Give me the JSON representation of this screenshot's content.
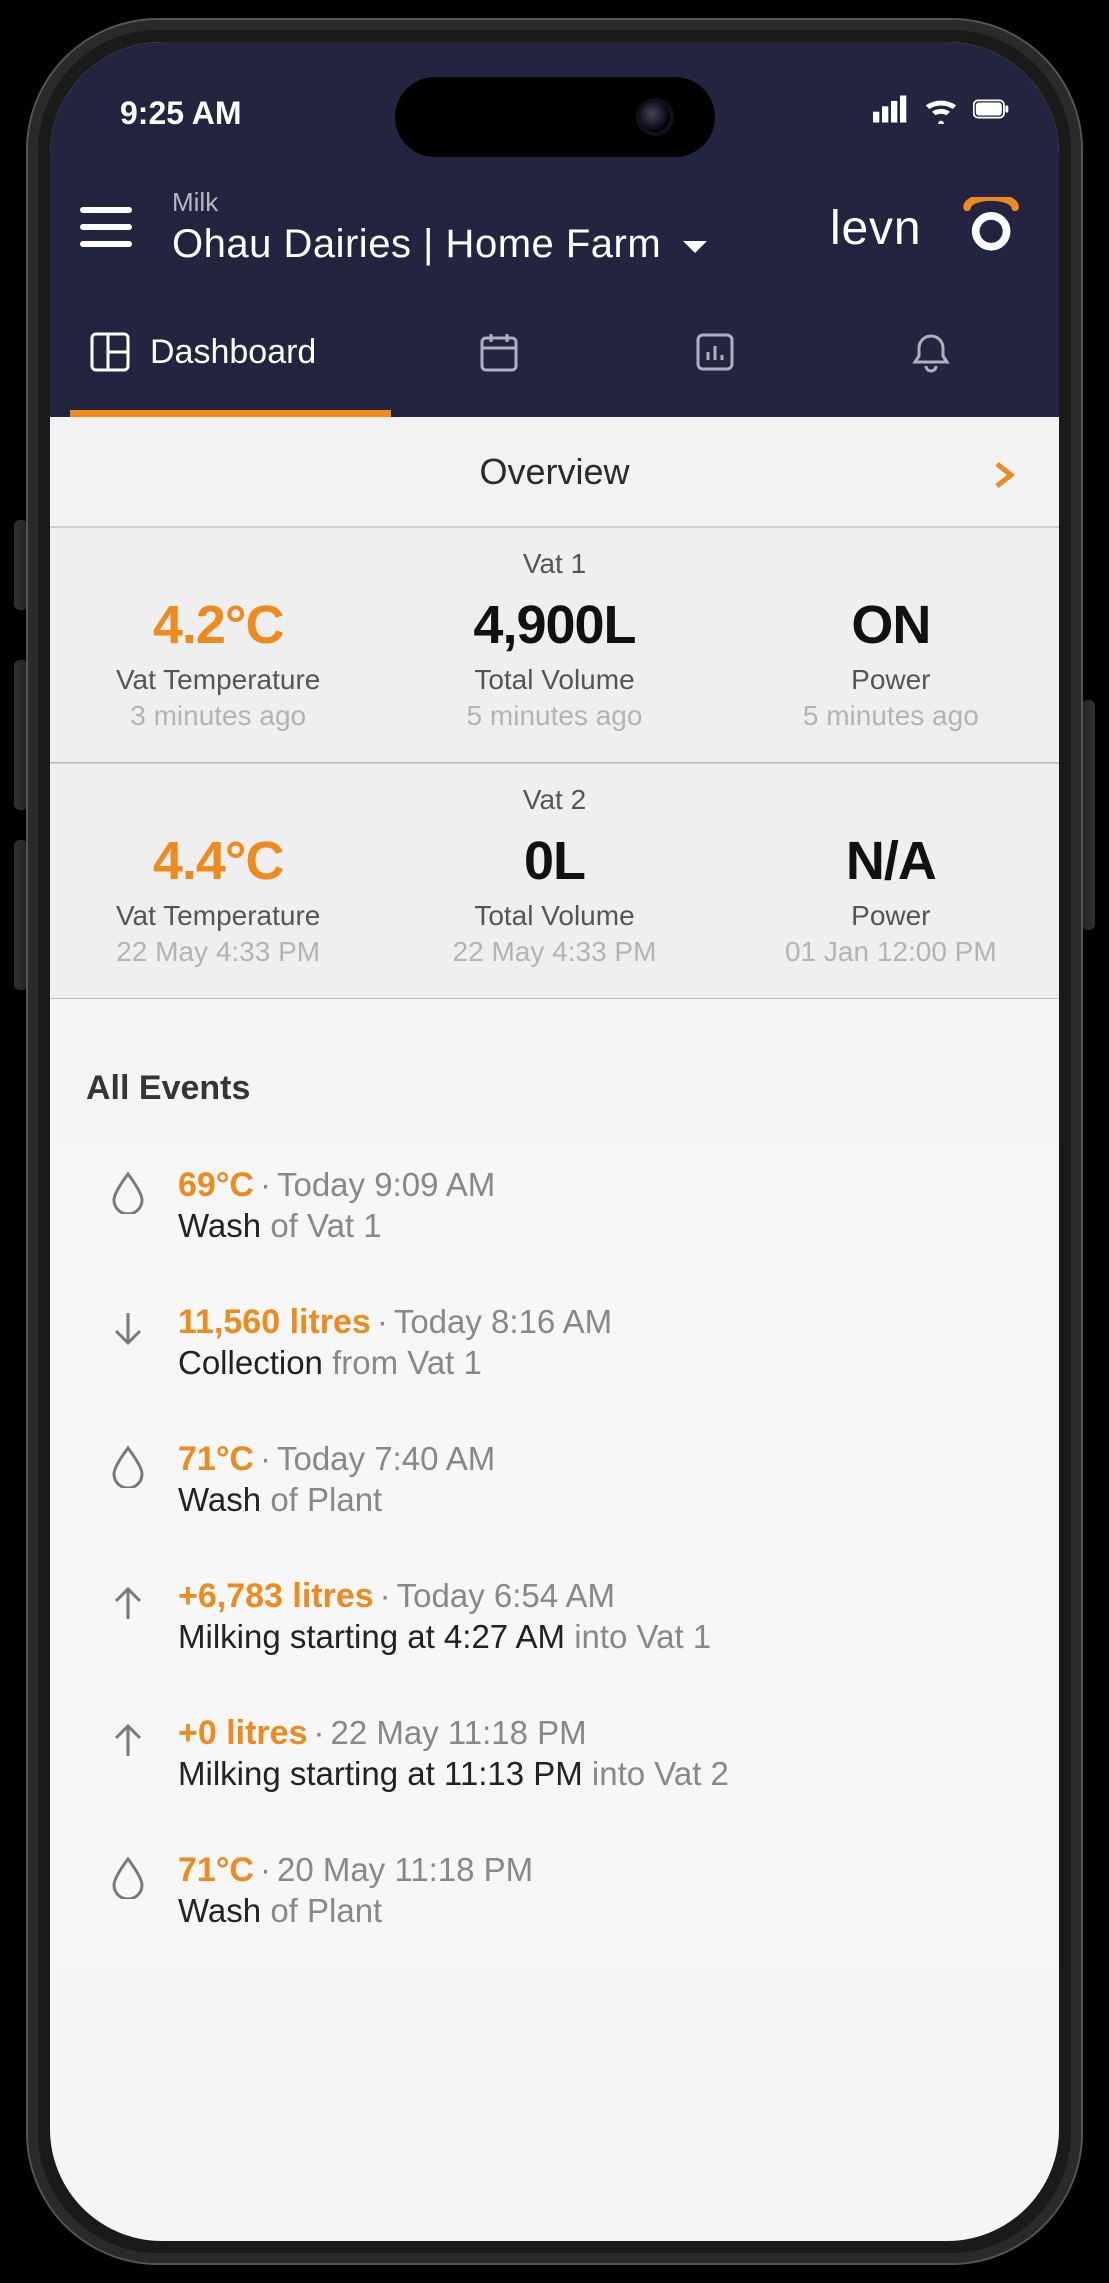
{
  "status_bar": {
    "time": "9:25 AM"
  },
  "header": {
    "category": "Milk",
    "farm": "Ohau Dairies | Home Farm"
  },
  "tabs": {
    "dashboard": "Dashboard"
  },
  "overview": {
    "label": "Overview"
  },
  "vats": [
    {
      "title": "Vat 1",
      "temp": {
        "value": "4.2°C",
        "label": "Vat Temperature",
        "time": "3 minutes ago"
      },
      "volume": {
        "value": "4,900L",
        "label": "Total Volume",
        "time": "5 minutes ago"
      },
      "power": {
        "value": "ON",
        "label": "Power",
        "time": "5 minutes ago"
      }
    },
    {
      "title": "Vat 2",
      "temp": {
        "value": "4.4°C",
        "label": "Vat Temperature",
        "time": "22 May 4:33 PM"
      },
      "volume": {
        "value": "0L",
        "label": "Total Volume",
        "time": "22 May 4:33 PM"
      },
      "power": {
        "value": "N/A",
        "label": "Power",
        "time": "01 Jan 12:00 PM"
      }
    }
  ],
  "events_title": "All Events",
  "events": [
    {
      "icon": "drop",
      "value": "69°C",
      "time": "Today 9:09 AM",
      "main": "Wash",
      "rest": "of Vat 1"
    },
    {
      "icon": "down",
      "value": "11,560 litres",
      "time": "Today 8:16 AM",
      "main": "Collection",
      "rest": "from Vat 1"
    },
    {
      "icon": "drop",
      "value": "71°C",
      "time": "Today 7:40 AM",
      "main": "Wash",
      "rest": "of Plant"
    },
    {
      "icon": "up",
      "value": "+6,783 litres",
      "time": "Today 6:54 AM",
      "main": "Milking starting at 4:27 AM",
      "rest": "into Vat 1"
    },
    {
      "icon": "up",
      "value": "+0 litres",
      "time": "22 May 11:18 PM",
      "main": "Milking starting at 11:13 PM",
      "rest": "into Vat 2"
    },
    {
      "icon": "drop",
      "value": "71°C",
      "time": "20 May 11:18 PM",
      "main": "Wash",
      "rest": "of Plant"
    }
  ]
}
